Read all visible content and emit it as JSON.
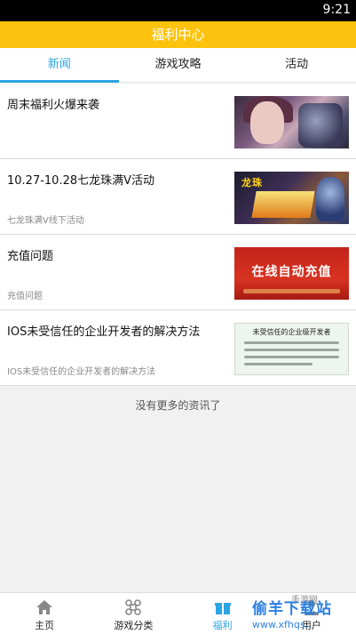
{
  "status_bar": {
    "time": "9:21"
  },
  "header": {
    "title": "福利中心"
  },
  "tabs": [
    {
      "label": "新闻",
      "active": true
    },
    {
      "label": "游戏攻略",
      "active": false
    },
    {
      "label": "活动",
      "active": false
    }
  ],
  "news": [
    {
      "title": "周末福利火爆来袭",
      "subtitle": ""
    },
    {
      "title": "10.27-10.28七龙珠满V活动",
      "subtitle": "七龙珠满V线下活动"
    },
    {
      "title": "充值问题",
      "subtitle": "充值问题"
    },
    {
      "title": "IOS未受信任的企业开发者的解决方法",
      "subtitle": "IOS未受信任的企业开发者的解决方法"
    }
  ],
  "thumbnails": {
    "item2_banner": "龙珠",
    "item3_label": "在线自动充值",
    "item4_heading": "未受信任的企业级开发者"
  },
  "footer_text": "没有更多的资讯了",
  "bottom_nav": [
    {
      "label": "主页",
      "icon": "home-icon"
    },
    {
      "label": "游戏分类",
      "icon": "command-icon"
    },
    {
      "label": "福利",
      "icon": "gift-icon",
      "active": true
    },
    {
      "label": "用户",
      "icon": "user-icon"
    }
  ],
  "watermark": {
    "main": "偷羊下载站",
    "url": "www.xfhqs.",
    "top": "手游网"
  },
  "colors": {
    "accent": "#2aa5e3",
    "header": "#fcc30e",
    "watermark": "#2b7fe0"
  }
}
